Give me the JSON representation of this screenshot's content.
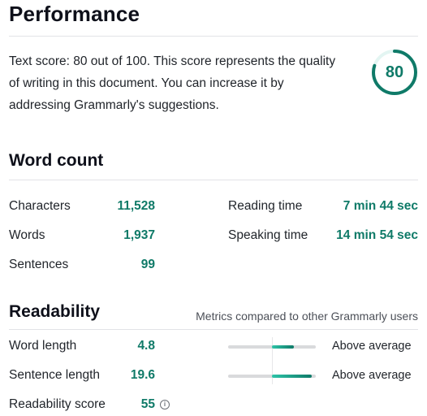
{
  "performance": {
    "title": "Performance",
    "description": "Text score: 80 out of 100. This score represents the quality of writing in this document. You can increase it by addressing Grammarly's suggestions.",
    "score": 80,
    "score_max": 100,
    "score_label": "80",
    "accent_color": "#0f7a68",
    "track_color": "#e3f5f2"
  },
  "word_count": {
    "title": "Word count",
    "left": [
      {
        "label": "Characters",
        "value": "11,528"
      },
      {
        "label": "Words",
        "value": "1,937"
      },
      {
        "label": "Sentences",
        "value": "99"
      }
    ],
    "right": [
      {
        "label": "Reading time",
        "value": "7 min 44 sec"
      },
      {
        "label": "Speaking time",
        "value": "14 min 54 sec"
      }
    ]
  },
  "readability": {
    "title": "Readability",
    "subtitle": "Metrics compared to other Grammarly users",
    "metrics": [
      {
        "label": "Word length",
        "value": "4.8",
        "comparison": "Above average",
        "bar_fill_from_center_fraction": 0.25
      },
      {
        "label": "Sentence length",
        "value": "19.6",
        "comparison": "Above average",
        "bar_fill_from_center_fraction": 0.45
      }
    ],
    "score": {
      "label": "Readability score",
      "value": "55",
      "info_icon": "info-icon",
      "info_glyph": "i"
    }
  }
}
